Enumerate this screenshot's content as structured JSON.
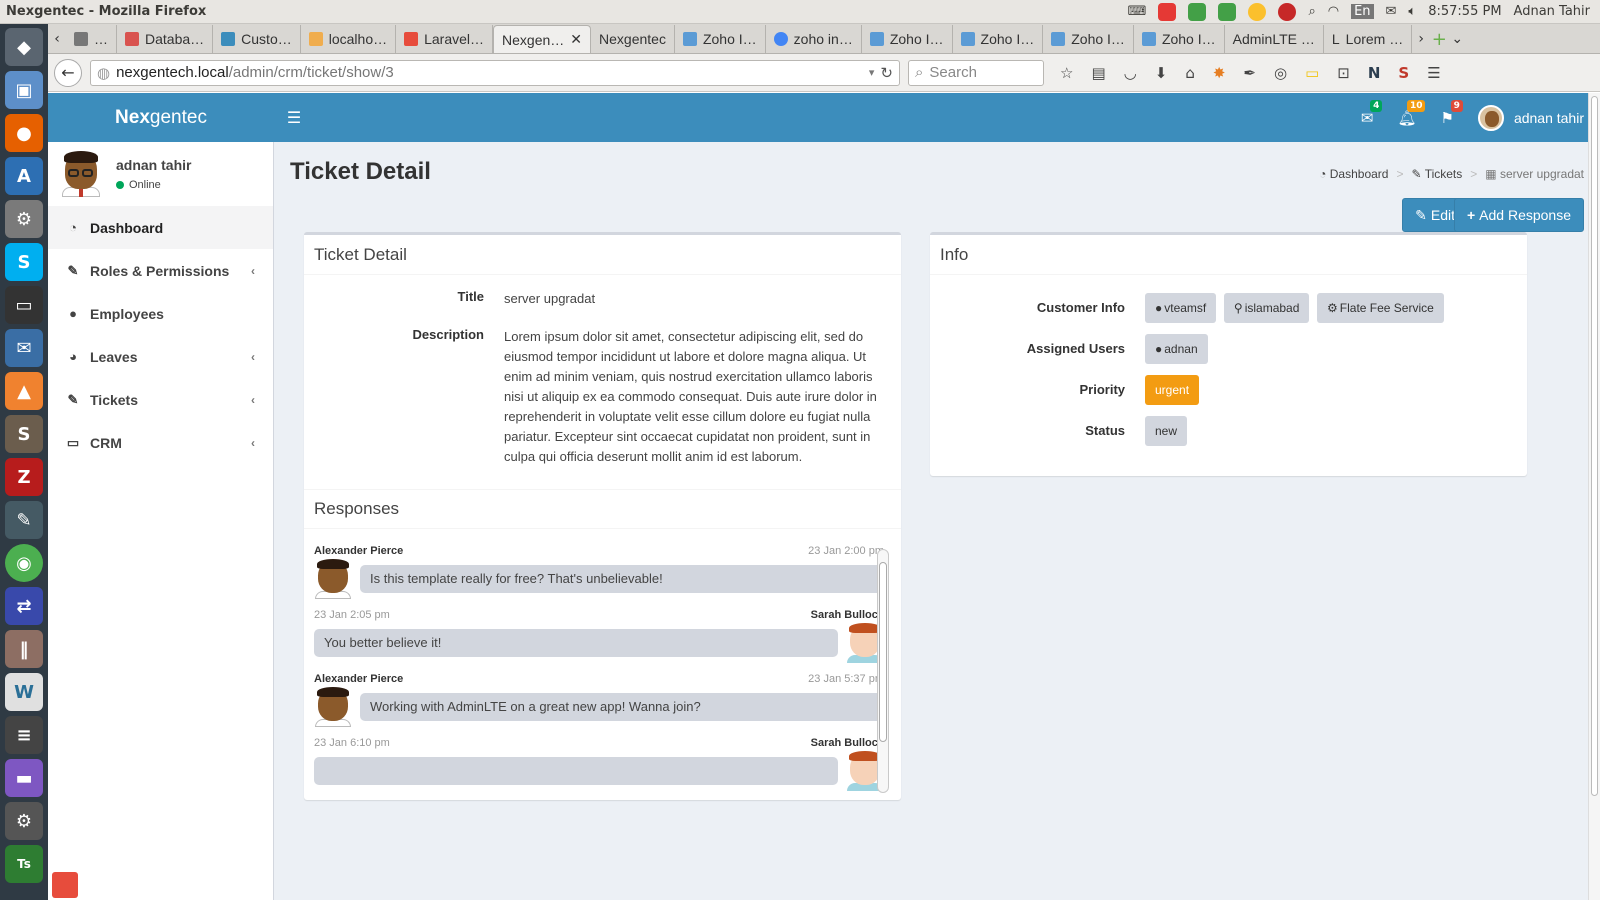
{
  "os": {
    "window_title": "Nexgentec - Mozilla Firefox",
    "time": "8:57:55 PM",
    "user": "Adnan Tahir",
    "lang": "En"
  },
  "browser": {
    "tabs": [
      {
        "label": "…",
        "color": "#777"
      },
      {
        "label": "Databa…",
        "color": "#d9534f"
      },
      {
        "label": "Custo…",
        "color": "#3c8dbc"
      },
      {
        "label": "localho…",
        "color": "#f0ad4e"
      },
      {
        "label": "Laravel…",
        "color": "#e74c3c"
      },
      {
        "label": "Nexgen…",
        "color": "#3c8dbc",
        "active": true
      },
      {
        "label": "Nexgentec",
        "color": "#3c8dbc"
      },
      {
        "label": "Zoho I…",
        "color": "#5b9bd5"
      },
      {
        "label": "zoho in…",
        "color": "#4285f4"
      },
      {
        "label": "Zoho I…",
        "color": "#5b9bd5"
      },
      {
        "label": "Zoho I…",
        "color": "#5b9bd5"
      },
      {
        "label": "Zoho I…",
        "color": "#5b9bd5"
      },
      {
        "label": "Zoho I…",
        "color": "#5b9bd5"
      },
      {
        "label": "AdminLTE …",
        "color": "#777"
      },
      {
        "label": "Lorem …",
        "color": "#333"
      }
    ],
    "url_host": "nexgentech.local",
    "url_path": "/admin/crm/ticket/show/3",
    "search_placeholder": "Search"
  },
  "app": {
    "logo_bold": "Nex",
    "logo_rest": "gentec",
    "header_user": "adnan tahir",
    "badges": {
      "messages": "4",
      "notifications": "10",
      "tasks": "9"
    },
    "badge_colors": {
      "messages": "#00a65a",
      "notifications": "#f39c12",
      "tasks": "#dd4b39"
    }
  },
  "sidebar": {
    "user_name": "adnan tahir",
    "status": "Online",
    "items": [
      {
        "label": "Dashboard",
        "icon": "dashboard-icon",
        "glyph": "◔",
        "active": true,
        "expand": false
      },
      {
        "label": "Roles & Permissions",
        "icon": "edit-icon",
        "glyph": "✎",
        "expand": true
      },
      {
        "label": "Employees",
        "icon": "user-icon",
        "glyph": "●",
        "expand": false
      },
      {
        "label": "Leaves",
        "icon": "pie-chart-icon",
        "glyph": "◕",
        "expand": true
      },
      {
        "label": "Tickets",
        "icon": "edit-icon",
        "glyph": "✎",
        "expand": true
      },
      {
        "label": "CRM",
        "icon": "laptop-icon",
        "glyph": "▭",
        "expand": true
      }
    ]
  },
  "page": {
    "title": "Ticket Detail",
    "breadcrumb": [
      "Dashboard",
      "Tickets",
      "server upgradat"
    ],
    "edit_label": "Edit",
    "add_response_label": "Add Response"
  },
  "ticket": {
    "box_title": "Ticket Detail",
    "title_label": "Title",
    "title_value": "server upgradat",
    "description_label": "Description",
    "description_value": "Lorem ipsum dolor sit amet, consectetur adipiscing elit, sed do eiusmod tempor incididunt ut labore et dolore magna aliqua. Ut enim ad minim veniam, quis nostrud exercitation ullamco laboris nisi ut aliquip ex ea commodo consequat. Duis aute irure dolor in reprehenderit in voluptate velit esse cillum dolore eu fugiat nulla pariatur. Excepteur sint occaecat cupidatat non proident, sunt in culpa qui officia deserunt mollit anim id est laborum.",
    "responses_title": "Responses"
  },
  "responses": [
    {
      "name": "Alexander Pierce",
      "time": "23 Jan 2:00 pm",
      "text": "Is this template really for free? That's unbelievable!",
      "side": "left"
    },
    {
      "name": "Sarah Bullock",
      "time": "23 Jan 2:05 pm",
      "text": "You better believe it!",
      "side": "right"
    },
    {
      "name": "Alexander Pierce",
      "time": "23 Jan 5:37 pm",
      "text": "Working with AdminLTE on a great new app! Wanna join?",
      "side": "left"
    },
    {
      "name": "Sarah Bullock",
      "time": "23 Jan 6:10 pm",
      "text": "",
      "side": "right"
    }
  ],
  "info": {
    "box_title": "Info",
    "customer_info_label": "Customer Info",
    "customer_name": "vteamsf",
    "customer_location": "islamabad",
    "customer_service": "Flate Fee Service",
    "assigned_users_label": "Assigned Users",
    "assigned_user": "adnan",
    "priority_label": "Priority",
    "priority_value": "urgent",
    "status_label": "Status",
    "status_value": "new"
  }
}
